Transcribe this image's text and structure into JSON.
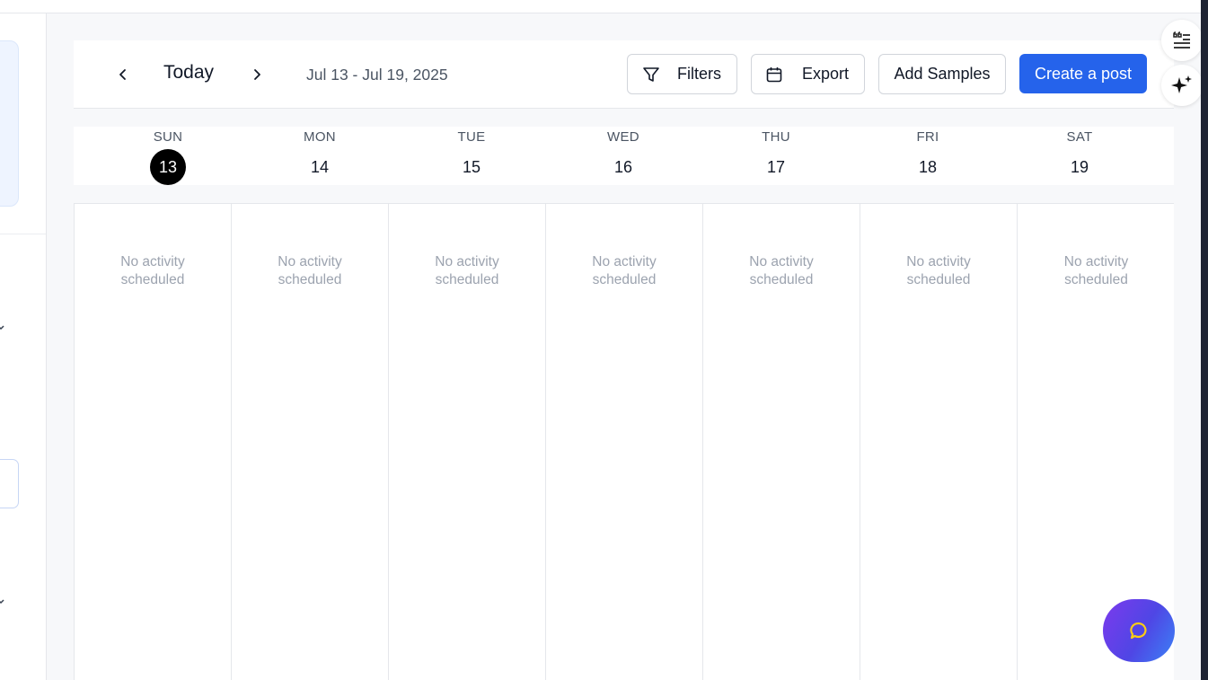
{
  "toolbar": {
    "today_label": "Today",
    "date_range": "Jul 13 - Jul 19, 2025",
    "filters_label": "Filters",
    "export_label": "Export",
    "add_samples_label": "Add Samples",
    "create_post_label": "Create a post",
    "prev_icon": "chevron-left-icon",
    "next_icon": "chevron-right-icon"
  },
  "days": [
    {
      "name": "SUN",
      "num": "13",
      "current": true
    },
    {
      "name": "MON",
      "num": "14",
      "current": false
    },
    {
      "name": "TUE",
      "num": "15",
      "current": false
    },
    {
      "name": "WED",
      "num": "16",
      "current": false
    },
    {
      "name": "THU",
      "num": "17",
      "current": false
    },
    {
      "name": "FRI",
      "num": "18",
      "current": false
    },
    {
      "name": "SAT",
      "num": "19",
      "current": false
    }
  ],
  "empty_text": "No activity scheduled",
  "colors": {
    "primary": "#2563eb",
    "current_day_bg": "#000000",
    "empty_text": "#9ca3af"
  }
}
